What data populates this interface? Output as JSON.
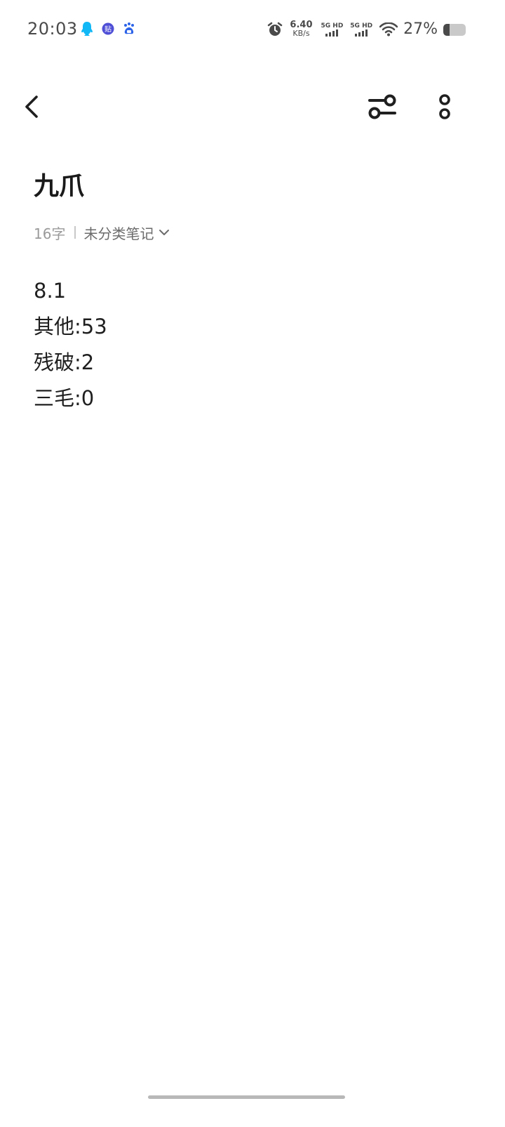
{
  "status_bar": {
    "time": "20:03",
    "apps": [
      "qq-icon",
      "tieba-icon",
      "baidu-icon"
    ],
    "net_speed_value": "6.40",
    "net_speed_unit": "KB/s",
    "sim1_label": "5G HD",
    "sim2_label": "5G HD",
    "battery_text": "27%",
    "battery_level": 0.27
  },
  "toolbar": {
    "back_icon": "chevron-left-icon",
    "filter_icon": "sliders-icon",
    "more_icon": "more-vertical-icon"
  },
  "note": {
    "title": "九爪",
    "word_count": "16字",
    "category": "未分类笔记",
    "lines": [
      "8.1",
      "其他:53",
      "残破:2",
      "三毛:0"
    ]
  },
  "colors": {
    "text_primary": "#1f1f1f",
    "text_secondary": "#9a9a9a",
    "qq_blue": "#12b7f5",
    "tieba_indigo": "#4e4fd6",
    "baidu_blue": "#2d64e8"
  }
}
